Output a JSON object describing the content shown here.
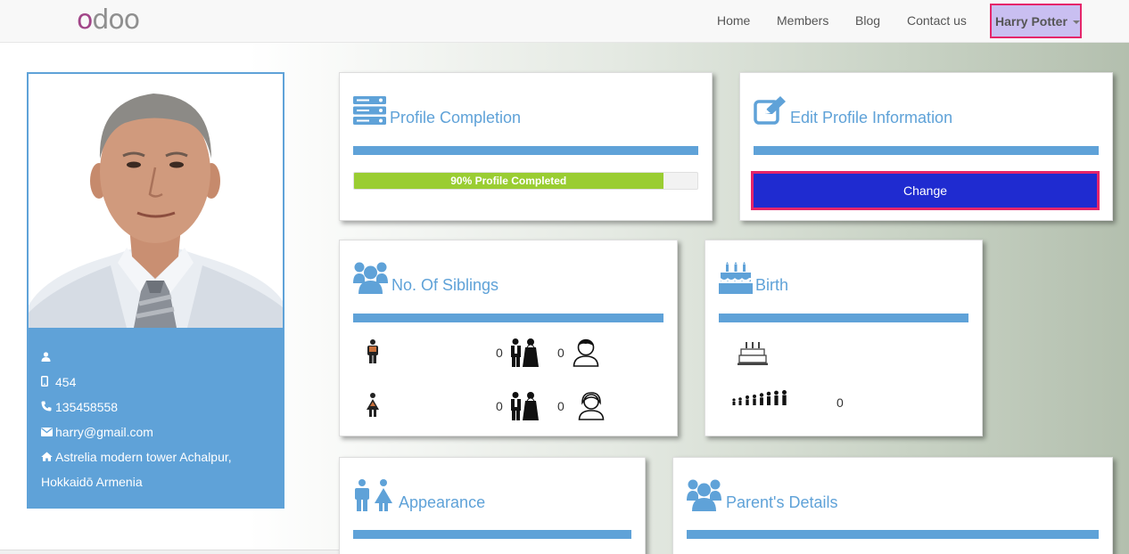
{
  "nav": {
    "logo": {
      "first": "o",
      "rest": "doo"
    },
    "links": [
      "Home",
      "Members",
      "Blog",
      "Contact us"
    ],
    "user": "Harry Potter"
  },
  "profile": {
    "id_value": "454",
    "phone": "135458558",
    "email": "harry@gmail.com",
    "address_line1": "Astrelia modern tower Achalpur,",
    "address_line2": "Hokkaidō Armenia"
  },
  "cards": {
    "completion": {
      "title": "Profile Completion",
      "progress_label": "90% Profile Completed",
      "progress_percent": 90
    },
    "edit": {
      "title": "Edit Profile Information",
      "button": "Change"
    },
    "siblings": {
      "title": "No. Of Siblings",
      "brothers_married": "0",
      "brothers_unmarried": "0",
      "sisters_married": "0",
      "sisters_unmarried": "0"
    },
    "birth": {
      "title": "Birth",
      "birth_order": "0"
    },
    "appearance": {
      "title": "Appearance"
    },
    "parents": {
      "title": "Parent's Details"
    }
  },
  "colors": {
    "accent": "#5fa2d8",
    "button": "#1f2bd0",
    "highlight": "#e5256a",
    "progress": "#9acd32"
  }
}
